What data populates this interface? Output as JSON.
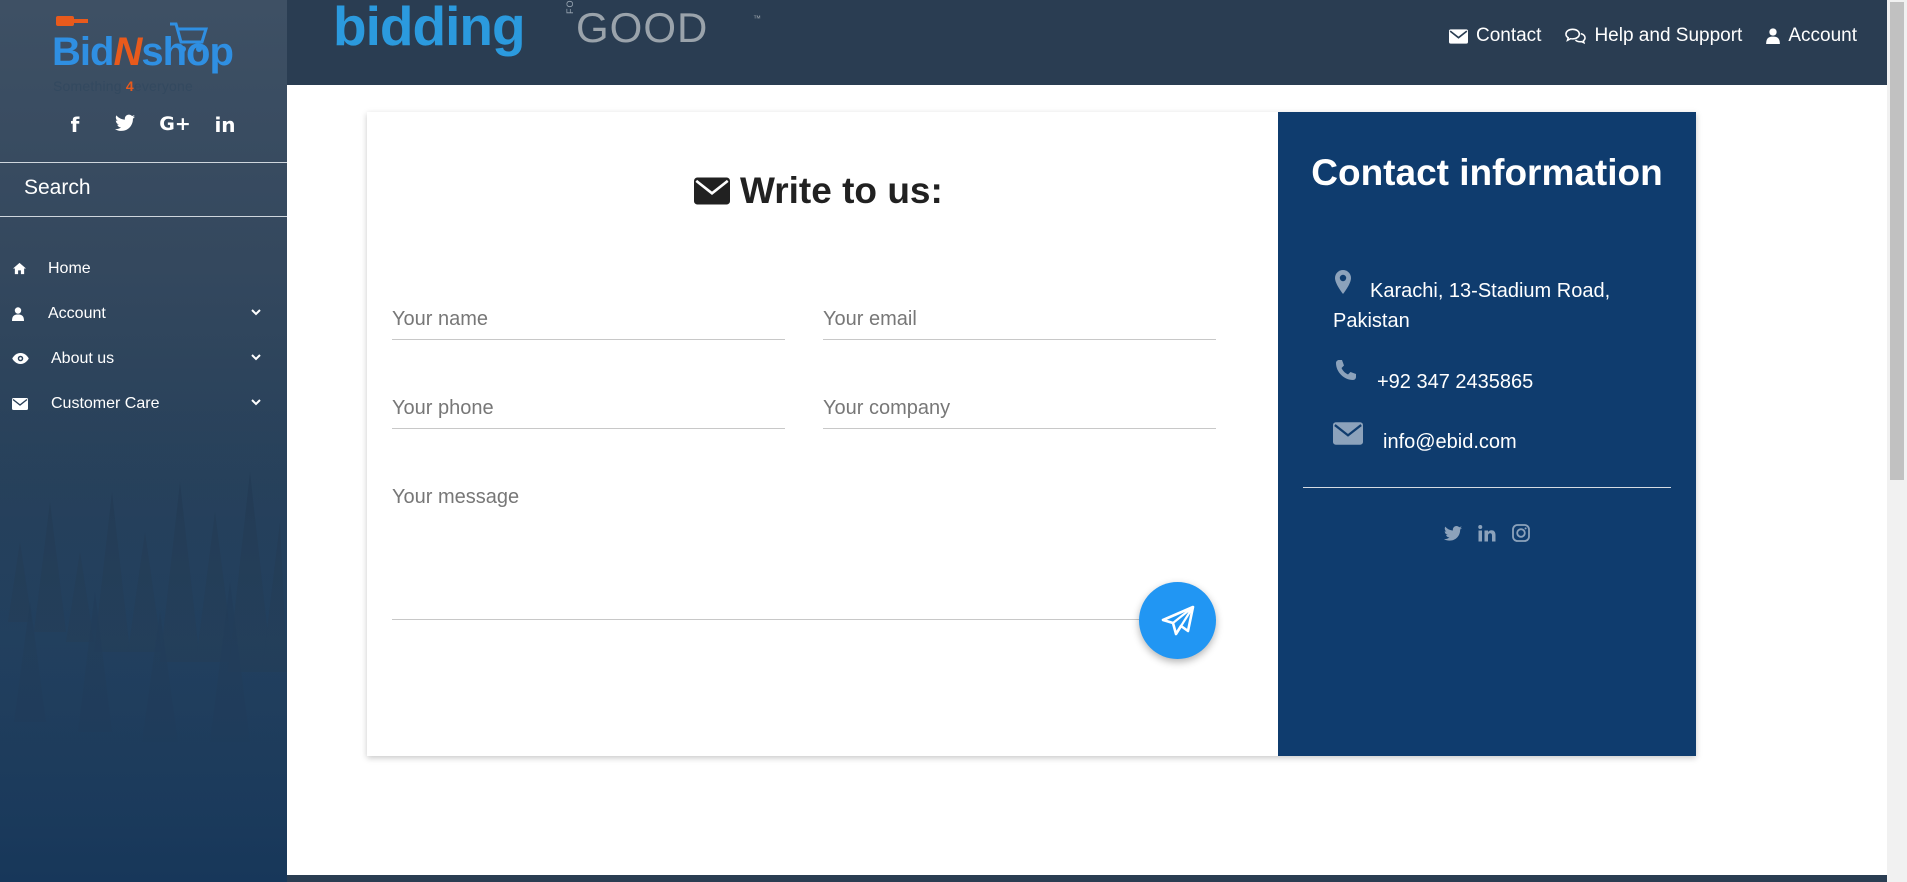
{
  "sidebar": {
    "logo_text_a": "Bid",
    "logo_text_n": "N",
    "logo_text_b": "shop",
    "logo_tag_a": "Something ",
    "logo_tag_4": "4",
    "logo_tag_b": "everyone",
    "social_icons": [
      "facebook-icon",
      "twitter-icon",
      "google-plus-icon",
      "linkedin-icon"
    ],
    "social_labels": [
      "f",
      "🐦",
      "G+",
      "in"
    ],
    "search_label": "Search",
    "items": [
      {
        "label": "Home",
        "icon": "home-icon",
        "has_submenu": false
      },
      {
        "label": "Account",
        "icon": "user-icon",
        "has_submenu": true
      },
      {
        "label": "About us",
        "icon": "eye-icon",
        "has_submenu": true
      },
      {
        "label": "Customer Care",
        "icon": "envelope-icon",
        "has_submenu": true
      }
    ]
  },
  "topbar": {
    "brand_bidding": "bidding",
    "brand_for": "FOR",
    "brand_good": "GOOD",
    "brand_tm": "™",
    "links": [
      {
        "label": "Contact",
        "icon": "envelope-icon"
      },
      {
        "label": "Help and Support",
        "icon": "comments-icon"
      },
      {
        "label": "Account",
        "icon": "user-icon"
      }
    ]
  },
  "form": {
    "title": "Write to us:",
    "name_placeholder": "Your name",
    "email_placeholder": "Your email",
    "phone_placeholder": "Your phone",
    "company_placeholder": "Your company",
    "message_placeholder": "Your message",
    "send_icon": "paper-plane-icon"
  },
  "contact_info": {
    "title": "Contact information",
    "address_line1": "Karachi, 13-Stadium Road,",
    "address_line2": "Pakistan",
    "phone": "+92 347 2435865",
    "email": "info@ebid.com",
    "social_icons": [
      "twitter-icon",
      "linkedin-icon",
      "instagram-icon"
    ]
  },
  "colors": {
    "accent": "#2196f3",
    "info_panel": "#0f3c6e",
    "topbar": "#2a3d52"
  }
}
